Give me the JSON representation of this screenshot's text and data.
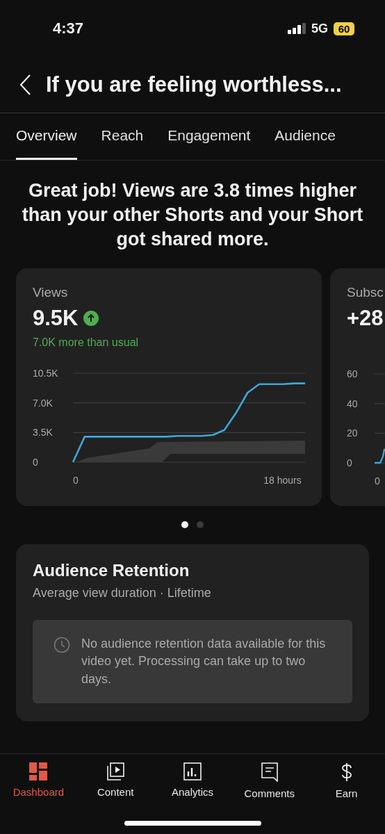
{
  "status_bar": {
    "time": "4:37",
    "network": "5G",
    "battery": "60"
  },
  "header": {
    "title": "If you are feeling worthless..."
  },
  "tabs": [
    {
      "label": "Overview",
      "selected": true
    },
    {
      "label": "Reach",
      "selected": false
    },
    {
      "label": "Engagement",
      "selected": false
    },
    {
      "label": "Audience",
      "selected": false
    }
  ],
  "headline": "Great job! Views are 3.8 times higher than your other Shorts and your Short got shared more.",
  "metric_cards": [
    {
      "kind": "full",
      "title": "Views",
      "value": "9.5K",
      "up": true,
      "note": "7.0K more than usual",
      "chart_data": {
        "type": "line",
        "x": [
          0,
          1,
          2,
          3,
          4,
          5,
          6,
          7,
          8,
          9,
          10,
          11,
          12,
          13,
          14,
          15,
          16,
          17,
          18,
          19,
          20
        ],
        "xlim": [
          0,
          20
        ],
        "ylim": [
          0,
          10500
        ],
        "xticks": [
          {
            "value": 0,
            "label": "0"
          },
          {
            "value": 18,
            "label": "18 hours"
          }
        ],
        "yticks": [
          {
            "value": 0,
            "label": "0"
          },
          {
            "value": 3500,
            "label": "3.5K"
          },
          {
            "value": 7000,
            "label": "7.0K"
          },
          {
            "value": 10500,
            "label": "10.5K"
          }
        ],
        "series": [
          {
            "color": "#3ea6d8",
            "values": [
              0,
              3000,
              3000,
              3000,
              3000,
              3000,
              3000,
              3000,
              3000,
              3100,
              3100,
              3100,
              3200,
              3800,
              5800,
              8200,
              9200,
              9200,
              9200,
              9300,
              9300
            ]
          }
        ]
      }
    },
    {
      "kind": "partial",
      "title": "Subsc",
      "value": "+28",
      "ytick_labels": [
        "60",
        "40",
        "20",
        "0"
      ],
      "xtick_labels": [
        "0"
      ]
    }
  ],
  "pager": [
    {
      "selected": true
    },
    {
      "selected": false
    }
  ],
  "retention": {
    "title": "Audience Retention",
    "subtitle": "Average view duration · Lifetime",
    "notice": "No audience retention data available for this video yet. Processing can take up to two days."
  },
  "nav": [
    {
      "label": "Dashboard",
      "kind": "dashboard",
      "selected": true
    },
    {
      "label": "Content",
      "kind": "content",
      "selected": false
    },
    {
      "label": "Analytics",
      "kind": "analytics",
      "selected": false
    },
    {
      "label": "Comments",
      "kind": "comments",
      "selected": false
    },
    {
      "label": "Earn",
      "kind": "earn",
      "selected": false
    }
  ]
}
